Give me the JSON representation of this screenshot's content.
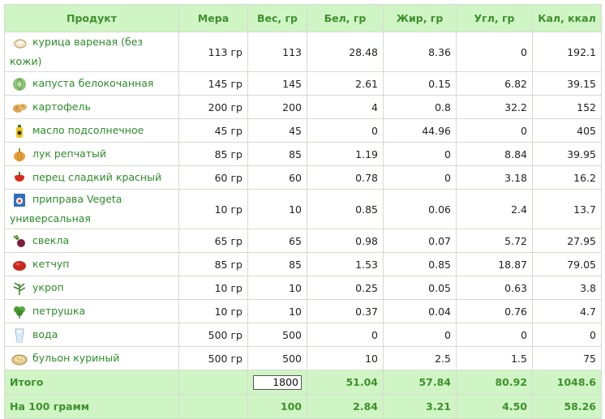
{
  "columns": {
    "product": "Продукт",
    "measure": "Мера",
    "weight": "Вес, гр",
    "protein": "Бел, гр",
    "fat": "Жир, гр",
    "carbs": "Угл, гр",
    "calories": "Кал, ккал"
  },
  "rows": [
    {
      "name": "курица вареная (без кожи)",
      "icon": "chicken-icon",
      "measure": "113 гр",
      "weight": "113",
      "protein": "28.48",
      "fat": "8.36",
      "carbs": "0",
      "calories": "192.1"
    },
    {
      "name": "капуста белокочанная",
      "icon": "cabbage-icon",
      "measure": "145 гр",
      "weight": "145",
      "protein": "2.61",
      "fat": "0.15",
      "carbs": "6.82",
      "calories": "39.15"
    },
    {
      "name": "картофель",
      "icon": "potato-icon",
      "measure": "200 гр",
      "weight": "200",
      "protein": "4",
      "fat": "0.8",
      "carbs": "32.2",
      "calories": "152"
    },
    {
      "name": "масло подсолнечное",
      "icon": "sunflower-oil-icon",
      "measure": "45 гр",
      "weight": "45",
      "protein": "0",
      "fat": "44.96",
      "carbs": "0",
      "calories": "405"
    },
    {
      "name": "лук репчатый",
      "icon": "onion-icon",
      "measure": "85 гр",
      "weight": "85",
      "protein": "1.19",
      "fat": "0",
      "carbs": "8.84",
      "calories": "39.95"
    },
    {
      "name": "перец сладкий красный",
      "icon": "red-pepper-icon",
      "measure": "60 гр",
      "weight": "60",
      "protein": "0.78",
      "fat": "0",
      "carbs": "3.18",
      "calories": "16.2"
    },
    {
      "name": "приправа Vegeta универсальная",
      "icon": "vegeta-icon",
      "measure": "10 гр",
      "weight": "10",
      "protein": "0.85",
      "fat": "0.06",
      "carbs": "2.4",
      "calories": "13.7"
    },
    {
      "name": "свекла",
      "icon": "beet-icon",
      "measure": "65 гр",
      "weight": "65",
      "protein": "0.98",
      "fat": "0.07",
      "carbs": "5.72",
      "calories": "27.95"
    },
    {
      "name": "кетчуп",
      "icon": "ketchup-icon",
      "measure": "85 гр",
      "weight": "85",
      "protein": "1.53",
      "fat": "0.85",
      "carbs": "18.87",
      "calories": "79.05"
    },
    {
      "name": "укроп",
      "icon": "dill-icon",
      "measure": "10 гр",
      "weight": "10",
      "protein": "0.25",
      "fat": "0.05",
      "carbs": "0.63",
      "calories": "3.8"
    },
    {
      "name": "петрушка",
      "icon": "parsley-icon",
      "measure": "10 гр",
      "weight": "10",
      "protein": "0.37",
      "fat": "0.04",
      "carbs": "0.76",
      "calories": "4.7"
    },
    {
      "name": "вода",
      "icon": "water-glass-icon",
      "measure": "500 гр",
      "weight": "500",
      "protein": "0",
      "fat": "0",
      "carbs": "0",
      "calories": "0"
    },
    {
      "name": "бульон куриный",
      "icon": "broth-icon",
      "measure": "500 гр",
      "weight": "500",
      "protein": "10",
      "fat": "2.5",
      "carbs": "1.5",
      "calories": "75"
    }
  ],
  "total": {
    "label": "Итого",
    "weight_input_value": "1800",
    "protein": "51.04",
    "fat": "57.84",
    "carbs": "80.92",
    "calories": "1048.6"
  },
  "per100": {
    "label": "На 100 грамм",
    "weight": "100",
    "protein": "2.84",
    "fat": "3.21",
    "carbs": "4.50",
    "calories": "58.26"
  },
  "colors": {
    "header_bg": "#d0f5c4",
    "header_text": "#3f8f2f",
    "link_text": "#2e8b2b",
    "border": "#d6dbd2"
  }
}
